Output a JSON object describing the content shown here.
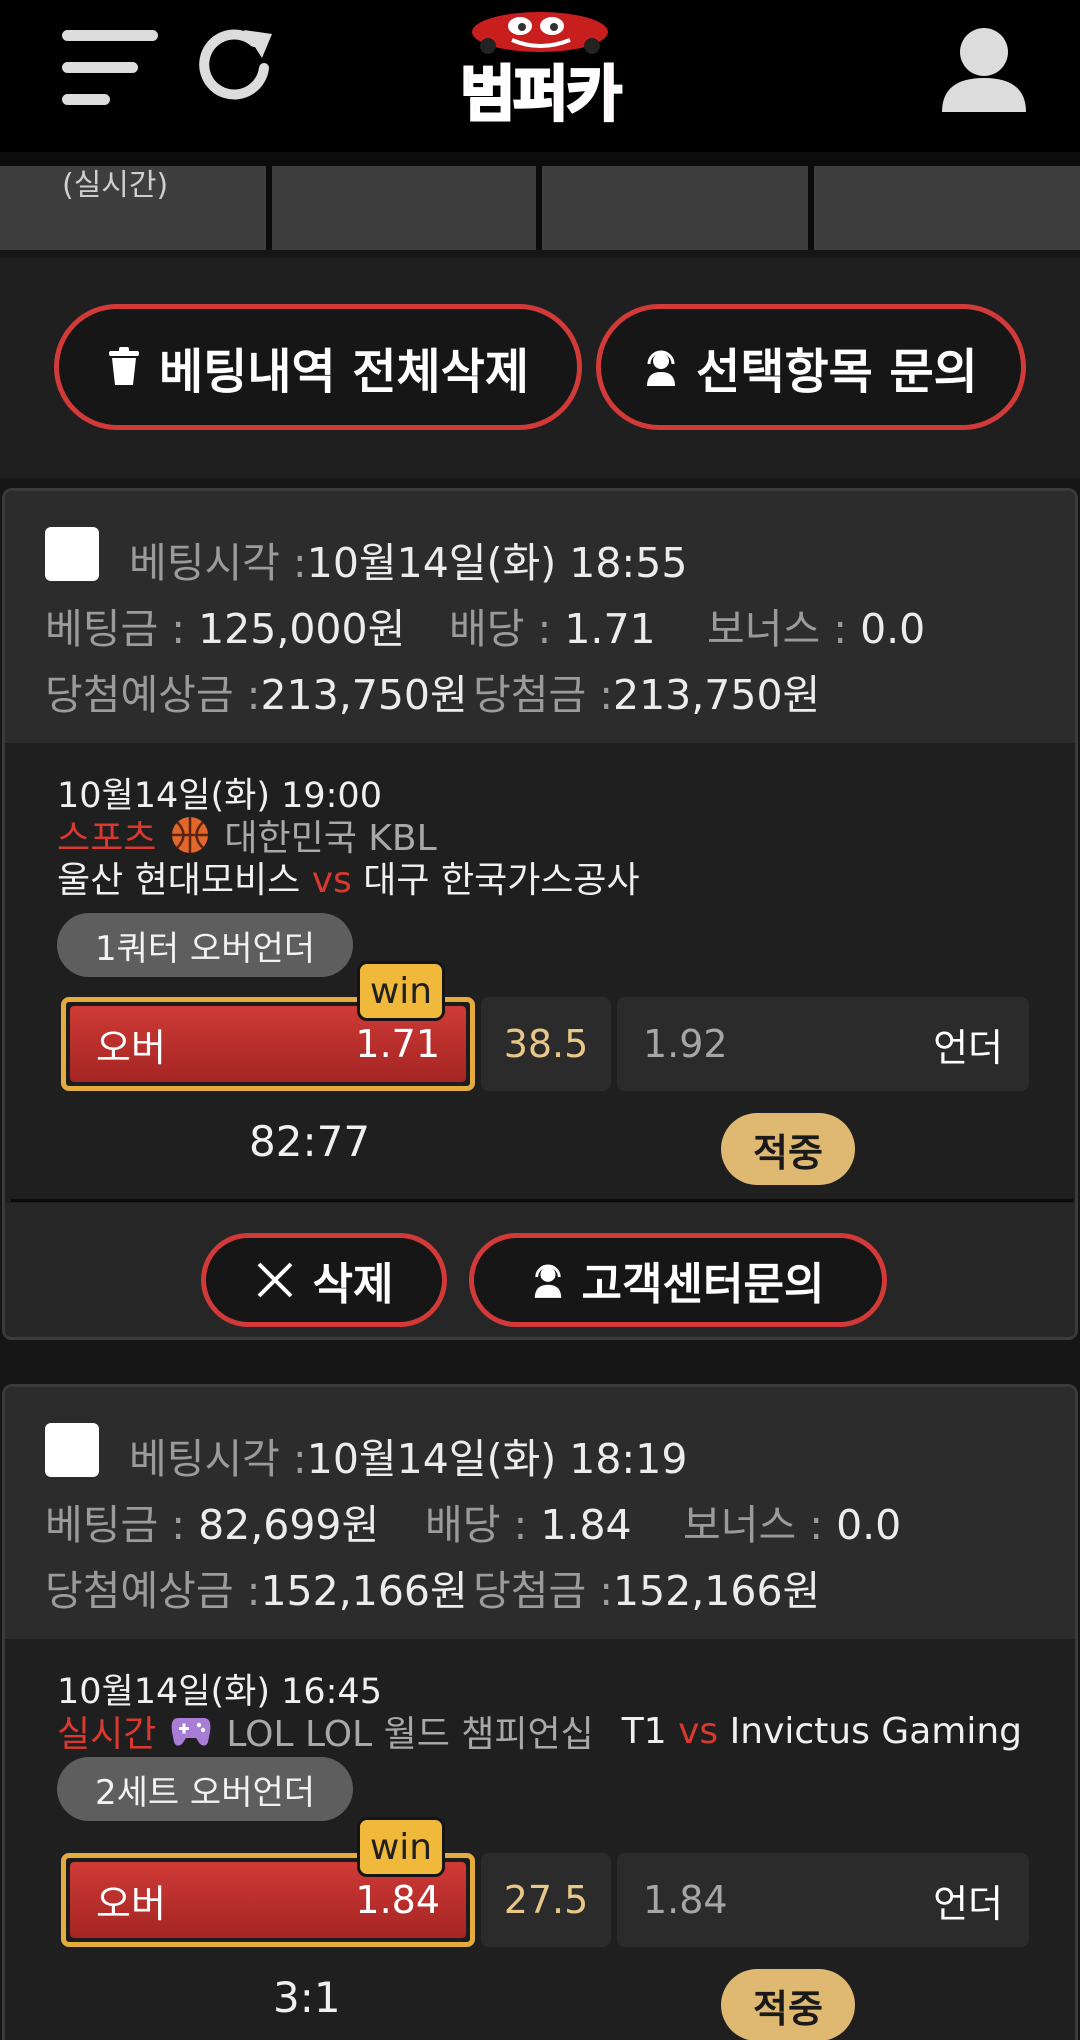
{
  "header": {
    "logo_text": "범퍼카"
  },
  "tabs": {
    "first_label": "(실시간)"
  },
  "actions": {
    "delete_all_label": "베팅내역 전체삭제",
    "inquiry_label": "선택항목 문의"
  },
  "colors": {
    "accent_red": "#d23a3a",
    "win_gold": "#f1b93b",
    "hit_gold": "#dfb971"
  },
  "bets": [
    {
      "time_label": "베팅시각 :",
      "time_value": "10월14일(화) 18:55",
      "amount_label": "베팅금 :",
      "amount_value": "125,000원",
      "odds_label": "배당 :",
      "odds_value": "1.71",
      "bonus_label": "보너스 :",
      "bonus_value": "0.0",
      "expected_label": "당첨예상금 :",
      "expected_value": "213,750원",
      "win_label": "당첨금 :",
      "win_value": "213,750원",
      "game_time": "10월14일(화) 19:00",
      "category": "스포츠",
      "sport_icon": "basketball-icon",
      "league": "대한민국 KBL",
      "home": "울산 현대모비스",
      "vs": "vs",
      "away": "대구 한국가스공사",
      "market": "1쿼터 오버언더",
      "win_badge": "win",
      "over_label": "오버",
      "over_odds": "1.71",
      "line": "38.5",
      "under_odds": "1.92",
      "under_label": "언더",
      "score": "82:77",
      "result": "적중",
      "delete_label": "삭제",
      "cs_label": "고객센터문의"
    },
    {
      "time_label": "베팅시각 :",
      "time_value": "10월14일(화) 18:19",
      "amount_label": "베팅금 :",
      "amount_value": "82,699원",
      "odds_label": "배당 :",
      "odds_value": "1.84",
      "bonus_label": "보너스 :",
      "bonus_value": "0.0",
      "expected_label": "당첨예상금 :",
      "expected_value": "152,166원",
      "win_label": "당첨금 :",
      "win_value": "152,166원",
      "game_time": "10월14일(화) 16:45",
      "category": "실시간",
      "sport_icon": "gamepad-icon",
      "league": "LOL LOL 월드 챔피언십",
      "home": "T1",
      "vs": "vs",
      "away": "Invictus Gaming",
      "market": "2세트 오버언더",
      "win_badge": "win",
      "over_label": "오버",
      "over_odds": "1.84",
      "line": "27.5",
      "under_odds": "1.84",
      "under_label": "언더",
      "score": "3:1",
      "result": "적중"
    }
  ]
}
